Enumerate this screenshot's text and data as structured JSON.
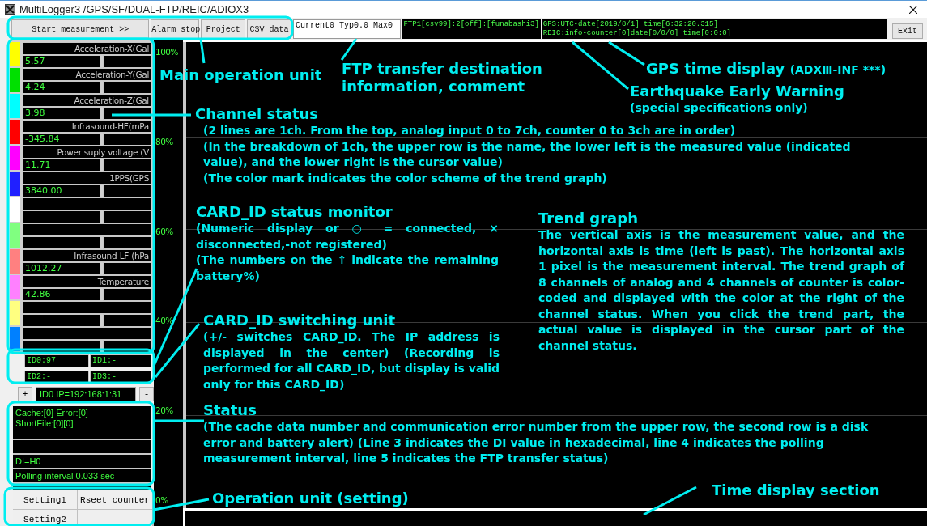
{
  "window": {
    "title": "MultiLogger3 /GPS/SF/DUAL-FTP/REIC/ADIOX3"
  },
  "toolbar": {
    "buttons": [
      "Start measurement >>",
      "Alarm stop",
      "Project",
      "CSV data"
    ],
    "measurement": "Current0 Typ0.0 Max0",
    "ftp": "FTP1[csv99]:2[off]:[funabashi3]",
    "gps_lines": [
      "GPS:UTC-date[2019/8/1] time[6:32:20.315]",
      "REIC:info-counter[0]date[0/0/0] time[0:0:0]"
    ],
    "exit": "Exit"
  },
  "channels": [
    {
      "name": "Acceleration-X(Gal",
      "value": "5.57",
      "color": "#ffff00"
    },
    {
      "name": "Acceleration-Y(Gal",
      "value": "4.24",
      "color": "#00e000"
    },
    {
      "name": "Acceleration-Z(Gal",
      "value": "3.98",
      "color": "#00ffff"
    },
    {
      "name": "Infrasound-HF(mPa",
      "value": "-345.84",
      "color": "#ff0000"
    },
    {
      "name": "Power suply voltage (V",
      "value": "11.71",
      "color": "#ff00ff"
    },
    {
      "name": "1PPS(GPS",
      "value": "3840.00",
      "color": "#2020ff"
    },
    {
      "color": "#ffffff"
    },
    {
      "color": "#80ff80"
    },
    {
      "name": "Infrasound-LF (hPa",
      "value": "1012.27",
      "color": "#ff8080"
    },
    {
      "name": "Temperature",
      "value": "42.86",
      "color": "#ff80ff"
    },
    {
      "color": "#ffff80"
    },
    {
      "color": "#0080ff"
    }
  ],
  "card_ids": [
    "ID0:97",
    "ID1:-",
    "ID2:-",
    "ID3:-"
  ],
  "card_switch": {
    "plus": "+",
    "ip": "ID0 IP=192:168:1:31",
    "minus": "-"
  },
  "status": {
    "line_1": "Cache:[0] Error:[0]",
    "line_2": "ShortFile:[0][0]",
    "di": "DI=H0",
    "polling": "Polling interval 0.033 sec"
  },
  "settings": [
    "Setting1",
    "Rseet counter",
    "Setting2"
  ],
  "scale": [
    "100%",
    "80%",
    "60%",
    "40%",
    "20%",
    "0%"
  ],
  "annotations": [
    {
      "title": "Main operation unit"
    },
    {
      "title": "FTP transfer destination information, comment"
    },
    {
      "title": "GPS time display",
      "note": "(ADXⅢ-INF ***)"
    },
    {
      "title": "Earthquake Early Warning",
      "paragraphs": [
        "(special specifications only)"
      ]
    },
    {
      "title": "Channel status",
      "paragraphs": [
        "(2 lines are 1ch. From the top, analog input 0 to 7ch, counter 0 to 3ch are in order)",
        "(In the breakdown of 1ch, the upper row is the name, the lower left is the measured value (indicated value), and the lower right is the cursor value)",
        "(The color mark indicates the color scheme of the trend graph)"
      ]
    },
    {
      "title": "CARD_ID status monitor",
      "paragraphs": [
        "(Numeric display or ○ = connected, × disconnected,-not registered)",
        "(The numbers on the ↑ indicate the remaining battery%)"
      ]
    },
    {
      "title": "Trend graph",
      "paragraphs": [
        "The vertical axis is the measurement value, and the horizontal axis is time (left is past). The horizontal axis 1 pixel is the measurement interval. The trend graph of 8 channels of analog and 4 channels of counter is color-coded and displayed with the color at the right of the channel status. When you click the trend part, the actual value is displayed in the cursor part of the channel status."
      ]
    },
    {
      "title": "CARD_ID switching unit",
      "paragraphs": [
        "(+/- switches CARD_ID. The IP address is displayed in the center) (Recording is performed for all CARD_ID, but display is valid only for this CARD_ID)"
      ]
    },
    {
      "title": "Status",
      "paragraphs": [
        "(The cache data number and communication error number from the upper row, the second row is a disk error and battery alert)   (Line 3 indicates the DI value in hexadecimal, line 4 indicates the polling measurement interval, line 5 indicates the FTP transfer status)"
      ]
    },
    {
      "title": "Operation unit (setting)"
    },
    {
      "title": "Time display section"
    }
  ]
}
